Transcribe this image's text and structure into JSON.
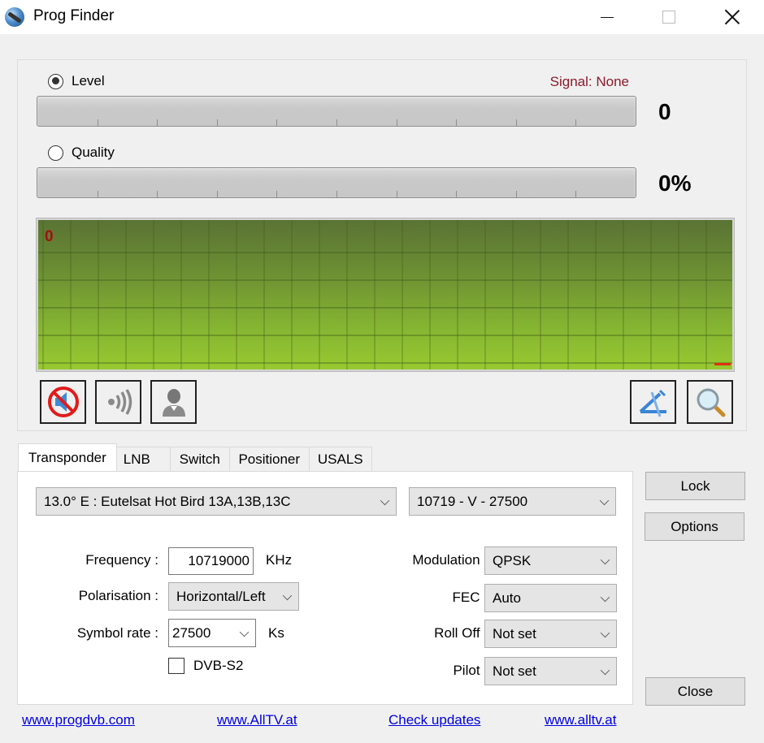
{
  "window": {
    "title": "Prog Finder",
    "controls": {
      "minimize": "minimize",
      "maximize": "maximize",
      "close": "close"
    }
  },
  "signal": {
    "mode_options": [
      {
        "label": "Level",
        "selected": true
      },
      {
        "label": "Quality",
        "selected": false
      }
    ],
    "status_text": "Signal: None",
    "level": {
      "value_text": "0",
      "fraction": 0
    },
    "quality": {
      "value_text": "0%",
      "fraction": 0
    },
    "graph": {
      "label": "0"
    },
    "colors": {
      "status": "#8b1a2b",
      "graph_top": "#5a7334",
      "graph_bottom": "#98c930",
      "graph_marker": "#e03010"
    }
  },
  "toolbar": {
    "left_buttons": [
      {
        "icon": "mute-icon",
        "title": "Sound off"
      },
      {
        "icon": "signal-wave-icon",
        "title": "Signal sound"
      },
      {
        "icon": "user-icon",
        "title": "User"
      }
    ],
    "right_buttons": [
      {
        "icon": "dish-align-icon",
        "title": "Dish alignment"
      },
      {
        "icon": "magnifier-icon",
        "title": "Search"
      }
    ]
  },
  "tabs": [
    {
      "label": "Transponder",
      "active": true
    },
    {
      "label": "LNB",
      "active": false
    },
    {
      "label": "Switch",
      "active": false
    },
    {
      "label": "Positioner",
      "active": false
    },
    {
      "label": "USALS",
      "active": false
    }
  ],
  "transponder": {
    "satellite": "13.0° E : Eutelsat Hot Bird 13A,13B,13C",
    "transponder": "10719 - V - 27500",
    "frequency": {
      "label": "Frequency :",
      "value": "10719000",
      "unit": "KHz"
    },
    "polarisation": {
      "label": "Polarisation :",
      "value": "Horizontal/Left"
    },
    "symbol_rate": {
      "label": "Symbol rate :",
      "value": "27500",
      "unit": "Ks"
    },
    "dvbs2": {
      "label": "DVB-S2",
      "checked": false
    },
    "modulation": {
      "label": "Modulation :",
      "value": "QPSK"
    },
    "fec": {
      "label": "FEC :",
      "value": "Auto"
    },
    "roll_off": {
      "label": "Roll Off :",
      "value": "Not set"
    },
    "pilot": {
      "label": "Pilot :",
      "value": "Not set"
    }
  },
  "buttons": {
    "lock": "Lock",
    "options": "Options",
    "close": "Close"
  },
  "links": [
    "www.progdvb.com",
    "www.AllTV.at",
    "Check updates",
    "www.alltv.at"
  ]
}
